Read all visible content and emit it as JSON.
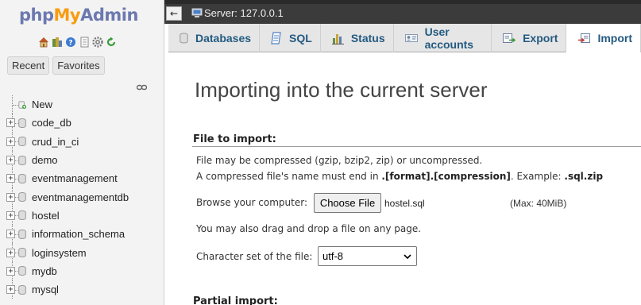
{
  "nav": {
    "logo": {
      "php": "php",
      "my": "My",
      "admin": "Admin"
    },
    "quick_icons": [
      "home-icon",
      "databases-icon",
      "help-icon",
      "docs-icon",
      "settings-icon",
      "reload-icon"
    ],
    "tabs": {
      "recent": "Recent",
      "favorites": "Favorites"
    },
    "link_icon": "chain-link-icon",
    "new_label": "New",
    "databases": [
      "code_db",
      "crud_in_ci",
      "demo",
      "eventmanagement",
      "eventmanagementdb",
      "hostel",
      "information_schema",
      "loginsystem",
      "mydb",
      "mysql"
    ]
  },
  "topbar": {
    "back_label": "←",
    "server_icon": "server-icon",
    "server_label": "Server: 127.0.0.1"
  },
  "menubar": {
    "tabs": [
      {
        "label": "Databases",
        "icon": "database-icon"
      },
      {
        "label": "SQL",
        "icon": "sql-icon"
      },
      {
        "label": "Status",
        "icon": "status-chart-icon"
      },
      {
        "label": "User accounts",
        "icon": "user-accounts-icon"
      },
      {
        "label": "Export",
        "icon": "export-icon"
      },
      {
        "label": "Import",
        "icon": "import-icon",
        "active": true
      }
    ]
  },
  "main": {
    "title": "Importing into the current server",
    "file_section": {
      "legend": "File to import:",
      "compression_note": "File may be compressed (gzip, bzip2, zip) or uncompressed.",
      "name_rule_prefix": "A compressed file's name must end in ",
      "name_rule_format": ".[format].[compression]",
      "name_rule_mid": ". Example: ",
      "name_rule_example": ".sql.zip",
      "browse_label": "Browse your computer:",
      "choose_button": "Choose File",
      "chosen_file": "hostel.sql",
      "max_size": "(Max: 40MiB)",
      "drag_note": "You may also drag and drop a file on any page.",
      "charset_label": "Character set of the file:",
      "charset_value": "utf-8"
    },
    "partial_section": {
      "legend": "Partial import:"
    }
  },
  "colors": {
    "logo_blue": "#6c78af",
    "logo_orange": "#f89c0e",
    "tab_text": "#235a81",
    "topbar": "#3b3b3b"
  }
}
